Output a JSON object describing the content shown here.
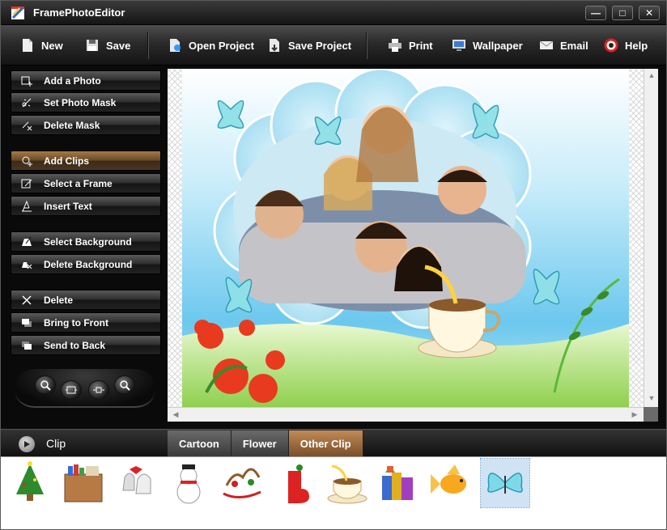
{
  "window": {
    "title": "FramePhotoEditor",
    "min": "—",
    "max": "□",
    "close": "✕"
  },
  "toolbar": {
    "new": "New",
    "save": "Save",
    "open_project": "Open Project",
    "save_project": "Save Project",
    "print": "Print",
    "wallpaper": "Wallpaper",
    "email": "Email",
    "help": "Help"
  },
  "sidebar": {
    "items": [
      {
        "label": "Add a Photo",
        "icon": "add-photo-icon"
      },
      {
        "label": "Set Photo Mask",
        "icon": "photo-mask-icon"
      },
      {
        "label": "Delete Mask",
        "icon": "delete-mask-icon"
      },
      {
        "label": "Add Clips",
        "icon": "add-clips-icon",
        "active": true
      },
      {
        "label": "Select a Frame",
        "icon": "frame-icon"
      },
      {
        "label": "Insert Text",
        "icon": "text-icon"
      },
      {
        "label": "Select Background",
        "icon": "background-icon"
      },
      {
        "label": "Delete Background",
        "icon": "delete-background-icon"
      },
      {
        "label": "Delete",
        "icon": "delete-icon"
      },
      {
        "label": "Bring to Front",
        "icon": "bring-front-icon"
      },
      {
        "label": "Send to Back",
        "icon": "send-back-icon"
      }
    ]
  },
  "zoom": {
    "icons": [
      "zoom-in-icon",
      "fit-window-icon",
      "actual-size-icon",
      "zoom-out-icon"
    ]
  },
  "clip_panel": {
    "label": "Clip",
    "tabs": [
      "Cartoon",
      "Flower",
      "Other Clip"
    ],
    "active_tab": "Other Clip",
    "items": [
      "christmas-tree",
      "bookshelf",
      "bells",
      "snowman",
      "sleigh",
      "stocking",
      "coffee-cup",
      "books",
      "goldfish",
      "butterfly"
    ],
    "selected": "butterfly"
  },
  "colors": {
    "accent": "#a87a46",
    "sky": "#7fd0f0",
    "grass": "#a7d86a"
  }
}
